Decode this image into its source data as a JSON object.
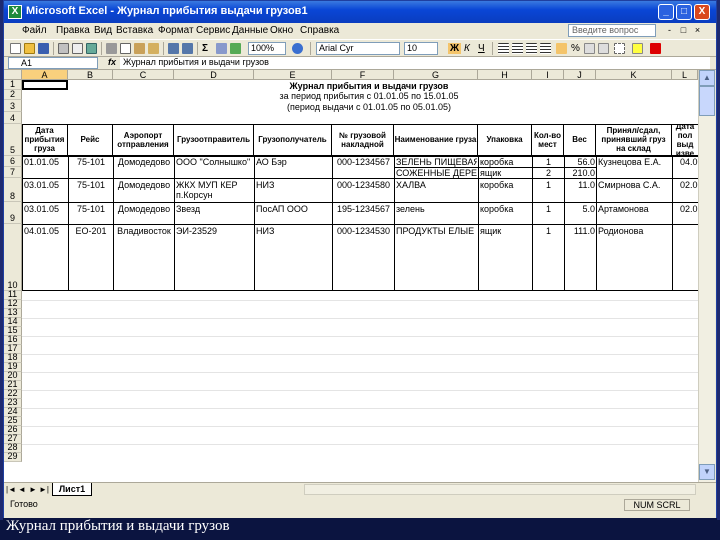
{
  "window": {
    "title": "Microsoft Excel - Журнал прибытия выдачи грузов1",
    "app_icon": "X",
    "controls": {
      "minimize": "_",
      "maximize": "□",
      "close": "X"
    }
  },
  "menu": {
    "items": [
      "Файл",
      "Правка",
      "Вид",
      "Вставка",
      "Формат",
      "Сервис",
      "Данные",
      "Окно",
      "Справка"
    ],
    "help_placeholder": "Введите вопрос",
    "doc_controls": [
      "-",
      "□",
      "×"
    ]
  },
  "toolbar": {
    "zoom": "100%",
    "font": "Arial Cyr",
    "font_size": "10",
    "bold": "Ж",
    "italic": "К",
    "underline": "Ч",
    "percent": "%",
    "sum": "Σ"
  },
  "formula_bar": {
    "name_box": "A1",
    "fx": "fx",
    "content": "Журнал прибытия и выдачи грузов"
  },
  "columns": [
    "A",
    "B",
    "C",
    "D",
    "E",
    "F",
    "G",
    "H",
    "I",
    "J",
    "K",
    "L"
  ],
  "rows": [
    "1",
    "2",
    "3",
    "4",
    "5",
    "6",
    "7",
    "8",
    "9",
    "10",
    "11",
    "12",
    "13",
    "14",
    "15",
    "16",
    "17",
    "18",
    "19",
    "20",
    "21",
    "22",
    "23",
    "24",
    "25",
    "26",
    "27",
    "28",
    "29"
  ],
  "sheet": {
    "title": "Журнал прибытия и выдачи грузов",
    "arrival_period": "за период прибытия с 01.01.05 по 15.01.05",
    "issue_period": "(период выдачи с 01.01.05 по 05.01.05)",
    "headers": [
      "Дата прибытия груза",
      "Рейс",
      "Аэропорт отправления",
      "Грузоотправитель",
      "Грузополучатель",
      "№ грузовой накладной",
      "Наименование груза",
      "Упаковка",
      "Кол-во мест",
      "Вес",
      "Принял/сдал, принявший груз на склад",
      "Дата пол выд изве"
    ],
    "rows": [
      [
        "01.01.05",
        "75-101",
        "Домодедово",
        "ООО \"Солнышко\"",
        "АО Бэр",
        "000-1234567",
        "ЗЕЛЕНЬ ПИЩЕВАЯ",
        "коробка",
        "1",
        "56.0",
        "Кузнецова Е.А.",
        "04.0"
      ],
      [
        "",
        "",
        "",
        "",
        "",
        "",
        "СОЖЕННЫЕ ДЕРЕВ",
        "ящик",
        "2",
        "210.0",
        "",
        ""
      ],
      [
        "03.01.05",
        "75-101",
        "Домодедово",
        "ЖКХ МУП КЕР п.Корсун",
        "НИЗ",
        "000-1234580",
        "ХАЛВА",
        "коробка",
        "1",
        "11.0",
        "Смирнова С.А.",
        "02.0"
      ],
      [
        "03.01.05",
        "75-101",
        "Домодедово",
        "Звезд",
        "ПосАП ООО",
        "195-1234567",
        "зелень",
        "коробка",
        "1",
        "5.0",
        "Артамонова",
        "02.0"
      ],
      [
        "04.01.05",
        "ЕО-201",
        "Владивосток",
        "ЭИ-23529",
        "НИЗ",
        "000-1234530",
        "ПРОДУКТЫ ЕЛЫЕ",
        "ящик",
        "1",
        "111.0",
        "Родионова",
        ""
      ]
    ]
  },
  "tabs": {
    "nav": [
      "|◄",
      "◄",
      "►",
      "►|"
    ],
    "sheet_name": "Лист1"
  },
  "status": {
    "ready": "Готово",
    "num": "NUM SCRL"
  },
  "caption": "Журнал прибытия и выдачи грузов",
  "colors": {
    "title_bar": "#0a46d6",
    "chrome": "#ece9d8",
    "background": "#0b1440",
    "selected_header": "#f9d07d"
  }
}
